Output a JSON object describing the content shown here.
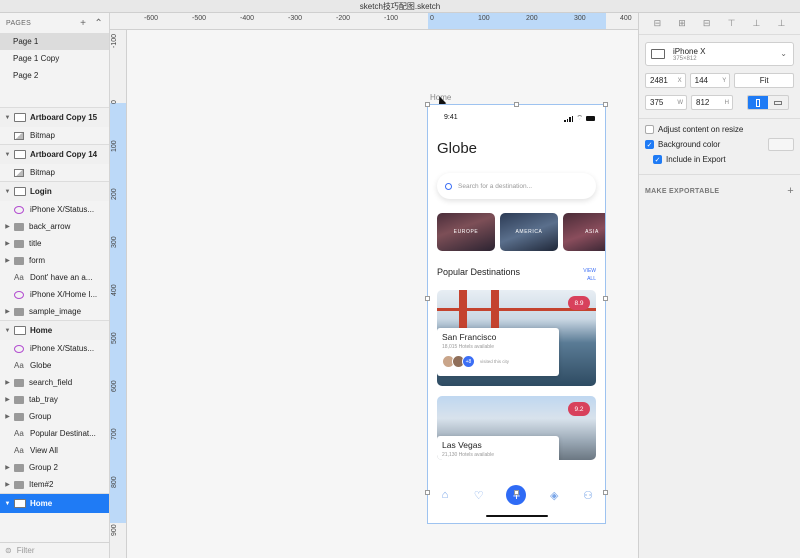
{
  "window": {
    "title": "sketch技巧配图.sketch"
  },
  "pages": {
    "header": "PAGES",
    "items": [
      "Page 1",
      "Page 1 Copy",
      "Page 2"
    ],
    "selected": "Page 1"
  },
  "layers": {
    "artboard1": {
      "name": "Artboard Copy 15",
      "children": [
        "Bitmap"
      ]
    },
    "artboard2": {
      "name": "Artboard Copy 14",
      "children": [
        "Bitmap"
      ]
    },
    "login": {
      "name": "Login",
      "children": [
        "iPhone X/Status...",
        "back_arrow",
        "title",
        "form",
        "Dont' have an a...",
        "iPhone X/Home I...",
        "sample_image"
      ]
    },
    "home": {
      "name": "Home",
      "children": [
        "iPhone X/Status...",
        "Globe",
        "search_field",
        "tab_tray",
        "Group",
        "Popular Destinat...",
        "View All",
        "Group 2",
        "Item#2"
      ]
    },
    "home_selected": {
      "name": "Home"
    },
    "filter_placeholder": "Filter"
  },
  "rulers": {
    "top": [
      "-600",
      "-500",
      "-400",
      "-300",
      "-200",
      "-100",
      "0",
      "100",
      "200",
      "300",
      "400"
    ],
    "left": [
      "-100",
      "0",
      "100",
      "200",
      "300",
      "400",
      "500",
      "600",
      "700",
      "800",
      "900"
    ]
  },
  "artboard": {
    "label": "Home",
    "status_time": "9:41",
    "app_title": "Globe",
    "search_placeholder": "Search for a destination...",
    "categories": [
      "EUROPE",
      "AMERICA",
      "ASIA"
    ],
    "popular_title": "Popular Destinations",
    "view_all": "VIEW ALL",
    "cards": [
      {
        "city": "San Francisco",
        "hotels": "18,015 Hotels available",
        "rating": "8.9",
        "visited": "visited this city",
        "extra_count": "+8"
      },
      {
        "city": "Las Vegas",
        "hotels": "21,130 Hotels available",
        "rating": "9.2"
      }
    ],
    "fab": "+"
  },
  "inspector": {
    "device_name": "iPhone X",
    "device_size": "375×812",
    "x": "2481",
    "y": "144",
    "w": "375",
    "h": "812",
    "x_label": "X",
    "y_label": "Y",
    "w_label": "W",
    "h_label": "H",
    "fit_label": "Fit",
    "adjust_content": "Adjust content on resize",
    "background_color": "Background color",
    "include_export": "Include in Export",
    "make_exportable": "MAKE EXPORTABLE",
    "colors": {
      "accent": "#1f7bf5",
      "rating": "#d8415c",
      "fab": "#2f6bf5"
    }
  }
}
